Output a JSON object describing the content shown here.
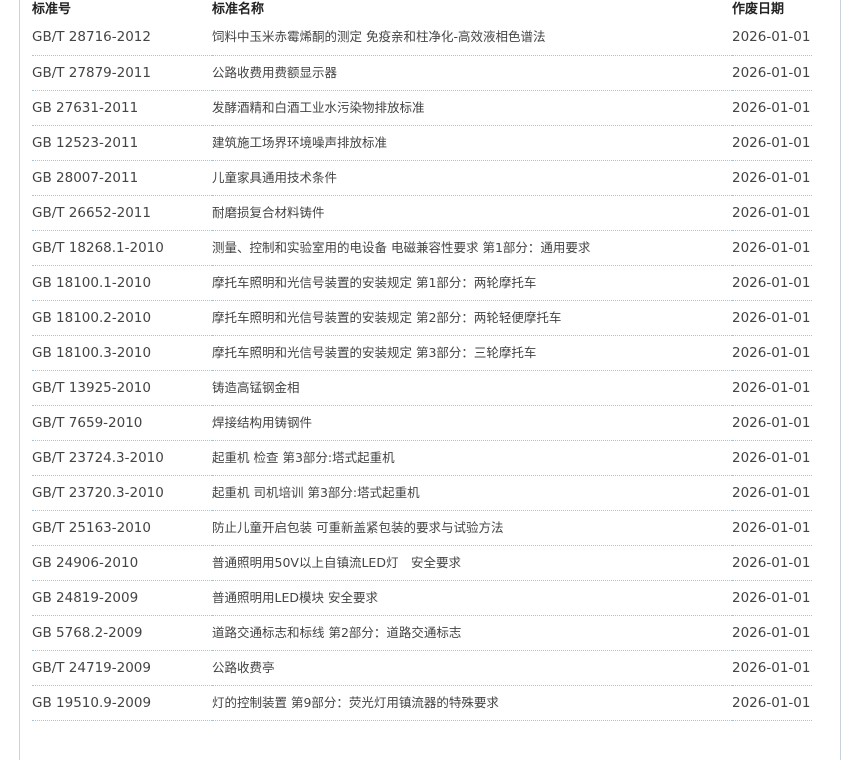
{
  "table": {
    "headers": {
      "code": "标准号",
      "name": "标准名称",
      "date": "作废日期"
    },
    "rows": [
      {
        "code": "GB/T 28716-2012",
        "name": "饲料中玉米赤霉烯酮的测定 免疫亲和柱净化-高效液相色谱法",
        "date": "2026-01-01"
      },
      {
        "code": "GB/T 27879-2011",
        "name": "公路收费用费额显示器",
        "date": "2026-01-01"
      },
      {
        "code": "GB 27631-2011",
        "name": "发酵酒精和白酒工业水污染物排放标准",
        "date": "2026-01-01"
      },
      {
        "code": "GB 12523-2011",
        "name": "建筑施工场界环境噪声排放标准",
        "date": "2026-01-01"
      },
      {
        "code": "GB 28007-2011",
        "name": "儿童家具通用技术条件",
        "date": "2026-01-01"
      },
      {
        "code": "GB/T 26652-2011",
        "name": "耐磨损复合材料铸件",
        "date": "2026-01-01"
      },
      {
        "code": "GB/T 18268.1-2010",
        "name": "测量、控制和实验室用的电设备 电磁兼容性要求 第1部分：通用要求",
        "date": "2026-01-01"
      },
      {
        "code": "GB 18100.1-2010",
        "name": "摩托车照明和光信号装置的安装规定 第1部分：两轮摩托车",
        "date": "2026-01-01"
      },
      {
        "code": "GB 18100.2-2010",
        "name": "摩托车照明和光信号装置的安装规定 第2部分：两轮轻便摩托车",
        "date": "2026-01-01"
      },
      {
        "code": "GB 18100.3-2010",
        "name": "摩托车照明和光信号装置的安装规定 第3部分：三轮摩托车",
        "date": "2026-01-01"
      },
      {
        "code": "GB/T 13925-2010",
        "name": "铸造高锰钢金相",
        "date": "2026-01-01"
      },
      {
        "code": "GB/T 7659-2010",
        "name": "焊接结构用铸钢件",
        "date": "2026-01-01"
      },
      {
        "code": "GB/T 23724.3-2010",
        "name": "起重机 检查 第3部分:塔式起重机",
        "date": "2026-01-01"
      },
      {
        "code": "GB/T 23720.3-2010",
        "name": "起重机 司机培训 第3部分:塔式起重机",
        "date": "2026-01-01"
      },
      {
        "code": "GB/T 25163-2010",
        "name": "防止儿童开启包装 可重新盖紧包装的要求与试验方法",
        "date": "2026-01-01"
      },
      {
        "code": "GB 24906-2010",
        "name": "普通照明用50V以上自镇流LED灯　安全要求",
        "date": "2026-01-01"
      },
      {
        "code": "GB 24819-2009",
        "name": "普通照明用LED模块 安全要求",
        "date": "2026-01-01"
      },
      {
        "code": "GB 5768.2-2009",
        "name": "道路交通标志和标线 第2部分：道路交通标志",
        "date": "2026-01-01"
      },
      {
        "code": "GB/T 24719-2009",
        "name": "公路收费亭",
        "date": "2026-01-01"
      },
      {
        "code": "GB 19510.9-2009",
        "name": "灯的控制装置 第9部分：荧光灯用镇流器的特殊要求",
        "date": "2026-01-01"
      }
    ]
  }
}
